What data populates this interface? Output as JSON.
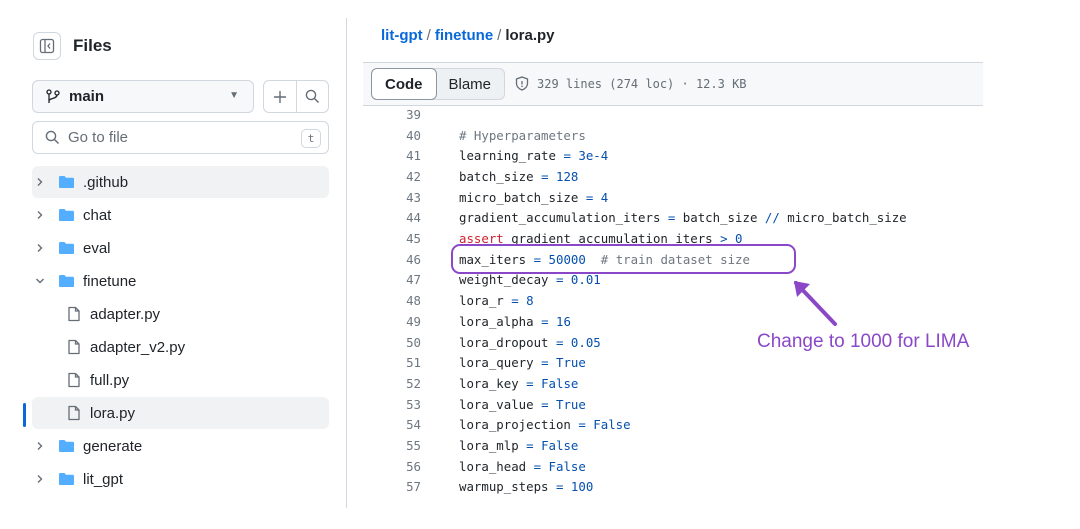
{
  "sidebar": {
    "title": "Files",
    "branch": "main",
    "goto_placeholder": "Go to file",
    "goto_shortcut": "t",
    "tree": [
      {
        "label": ".github",
        "kind": "folder",
        "expanded": false
      },
      {
        "label": "chat",
        "kind": "folder",
        "expanded": false
      },
      {
        "label": "eval",
        "kind": "folder",
        "expanded": false
      },
      {
        "label": "finetune",
        "kind": "folder",
        "expanded": true
      },
      {
        "label": "adapter.py",
        "kind": "file"
      },
      {
        "label": "adapter_v2.py",
        "kind": "file"
      },
      {
        "label": "full.py",
        "kind": "file"
      },
      {
        "label": "lora.py",
        "kind": "file",
        "selected": true
      },
      {
        "label": "generate",
        "kind": "folder",
        "expanded": false
      },
      {
        "label": "lit_gpt",
        "kind": "folder",
        "expanded": false
      }
    ]
  },
  "breadcrumb": {
    "repo": "lit-gpt",
    "separator": "/",
    "folder": "finetune",
    "file": "lora.py"
  },
  "file_header": {
    "code_tab": "Code",
    "blame_tab": "Blame",
    "meta": "329 lines (274 loc) · 12.3 KB"
  },
  "code": {
    "lines": [
      {
        "n": "39",
        "text": ""
      },
      {
        "n": "40",
        "text": "# Hyperparameters"
      },
      {
        "n": "41",
        "text": "learning_rate = 3e-4"
      },
      {
        "n": "42",
        "text": "batch_size = 128"
      },
      {
        "n": "43",
        "text": "micro_batch_size = 4"
      },
      {
        "n": "44",
        "text": "gradient_accumulation_iters = batch_size // micro_batch_size"
      },
      {
        "n": "45",
        "text": "assert gradient_accumulation_iters > 0"
      },
      {
        "n": "46",
        "text": "max_iters = 50000  # train dataset size"
      },
      {
        "n": "47",
        "text": "weight_decay = 0.01"
      },
      {
        "n": "48",
        "text": "lora_r = 8"
      },
      {
        "n": "49",
        "text": "lora_alpha = 16"
      },
      {
        "n": "50",
        "text": "lora_dropout = 0.05"
      },
      {
        "n": "51",
        "text": "lora_query = True"
      },
      {
        "n": "52",
        "text": "lora_key = False"
      },
      {
        "n": "53",
        "text": "lora_value = True"
      },
      {
        "n": "54",
        "text": "lora_projection = False"
      },
      {
        "n": "55",
        "text": "lora_mlp = False"
      },
      {
        "n": "56",
        "text": "lora_head = False"
      },
      {
        "n": "57",
        "text": "warmup_steps = 100"
      }
    ]
  },
  "annotation": {
    "text": "Change to 1000 for LIMA",
    "color": "#8a48c8"
  },
  "colors": {
    "link": "#0969da",
    "folder": "#54aeff",
    "keyword": "#cf222e",
    "constant": "#0550ae",
    "comment": "#6e7781"
  },
  "icons": [
    "sidebar-collapse-icon",
    "branch-icon",
    "chevron-down-icon",
    "plus-icon",
    "search-icon",
    "folder-icon",
    "file-icon",
    "chevron-right-icon",
    "shield-icon"
  ]
}
